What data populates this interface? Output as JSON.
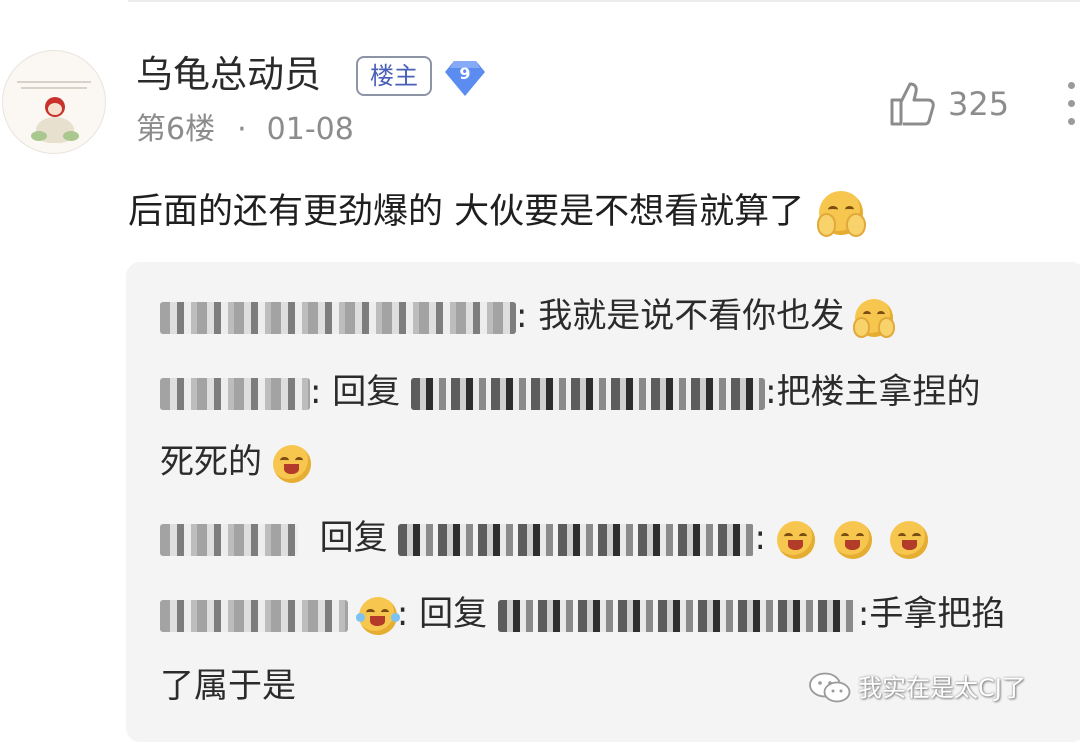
{
  "post": {
    "author": "乌龟总动员",
    "op_badge": "楼主",
    "level": "9",
    "floor": "第6楼",
    "separator": "·",
    "date": "01-08",
    "likes": "325",
    "content": "后面的还有更劲爆的 大伙要是不想看就算了"
  },
  "replies": [
    {
      "text": ": 我就是说不看你也发"
    },
    {
      "reply_word": ": 回复",
      "text": ":把楼主拿捏的",
      "text_cont": "死死的"
    },
    {
      "reply_word": "回复",
      "text": ":"
    },
    {
      "reply_word": ": 回复",
      "text": ":手拿把掐",
      "text_cont": "了属于是"
    }
  ],
  "watermark": "我实在是太CJ了",
  "icons": {
    "like": "thumbs-up-icon",
    "more": "more-vertical-icon",
    "level": "diamond-level-icon",
    "watermark": "wechat-icon",
    "emoji_blush": "blush-hands-emoji",
    "emoji_grin": "grinning-squint-emoji",
    "emoji_tears": "tears-of-joy-emoji"
  },
  "colors": {
    "op_badge_text": "#4a5fb8",
    "level_badge": "#5b8cf0",
    "meta_text": "#8c8c8c",
    "reply_bg": "#f4f4f5"
  }
}
